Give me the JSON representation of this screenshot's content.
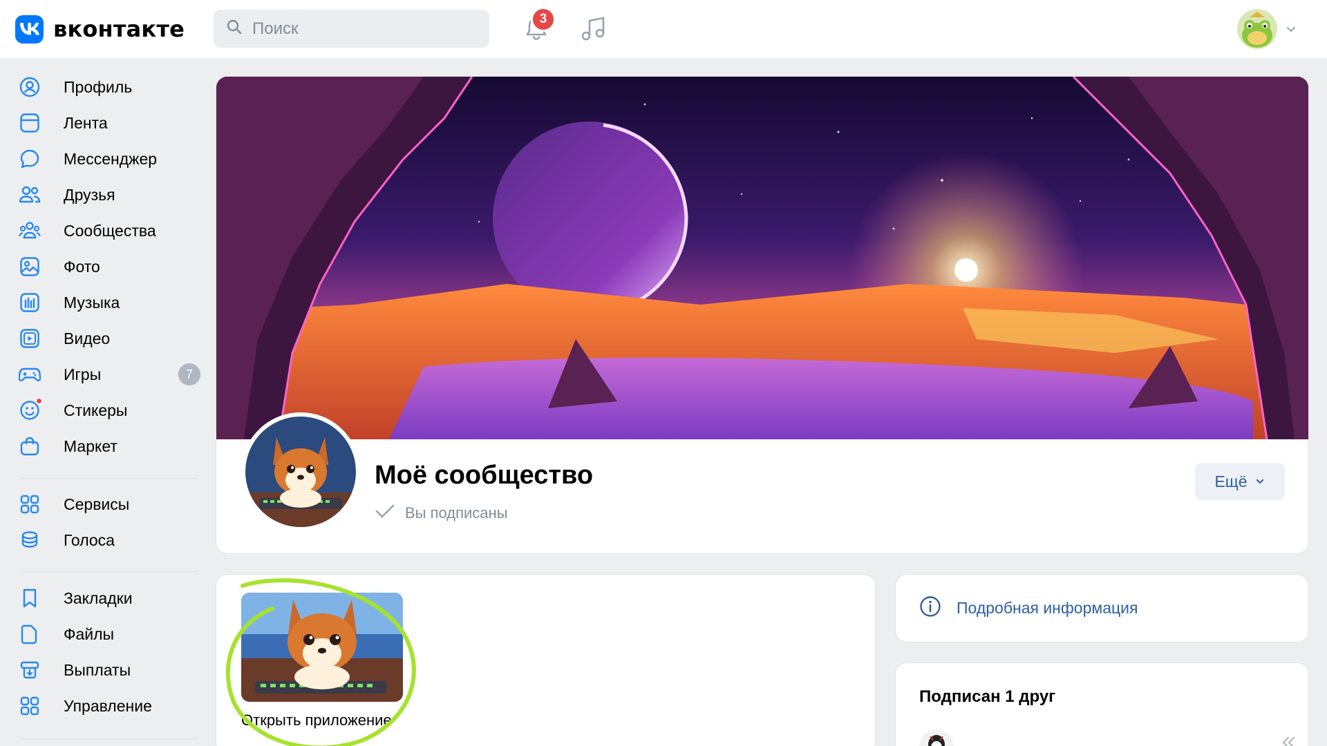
{
  "app": {
    "logo_text": "вконтакте"
  },
  "search": {
    "placeholder": "Поиск"
  },
  "notifications": {
    "count": "3"
  },
  "sidebar": {
    "items": [
      {
        "label": "Профиль",
        "icon": "profile-icon"
      },
      {
        "label": "Лента",
        "icon": "feed-icon"
      },
      {
        "label": "Мессенджер",
        "icon": "messenger-icon"
      },
      {
        "label": "Друзья",
        "icon": "friends-icon"
      },
      {
        "label": "Сообщества",
        "icon": "communities-icon"
      },
      {
        "label": "Фото",
        "icon": "photo-icon"
      },
      {
        "label": "Музыка",
        "icon": "music-icon"
      },
      {
        "label": "Видео",
        "icon": "video-icon"
      },
      {
        "label": "Игры",
        "icon": "games-icon",
        "count": "7"
      },
      {
        "label": "Стикеры",
        "icon": "stickers-icon"
      },
      {
        "label": "Маркет",
        "icon": "market-icon"
      },
      {
        "label": "Сервисы",
        "icon": "services-icon"
      },
      {
        "label": "Голоса",
        "icon": "votes-icon"
      },
      {
        "label": "Закладки",
        "icon": "bookmarks-icon"
      },
      {
        "label": "Файлы",
        "icon": "files-icon"
      },
      {
        "label": "Выплаты",
        "icon": "payouts-icon"
      },
      {
        "label": "Управление",
        "icon": "management-icon"
      }
    ]
  },
  "community": {
    "title": "Моё сообщество",
    "status": "Вы подписаны",
    "more_label": "Ещё"
  },
  "app_card": {
    "label": "Открыть приложение"
  },
  "info_card": {
    "label": "Подробная информация"
  },
  "friends_card": {
    "title": "Подписан 1 друг"
  },
  "colors": {
    "accent": "#0077ff",
    "link": "#2d5fa0",
    "badge": "#e64646",
    "highlight": "#a6e22e"
  }
}
